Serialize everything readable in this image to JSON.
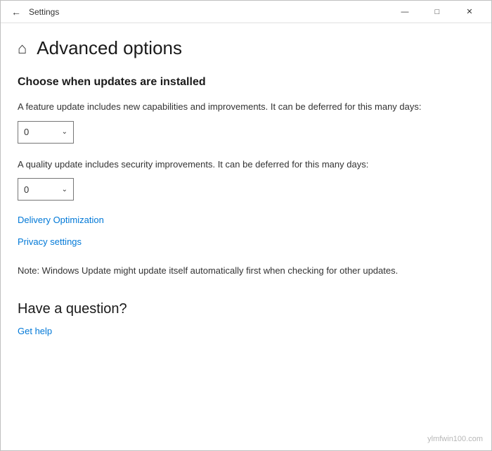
{
  "window": {
    "title": "Settings"
  },
  "titlebar": {
    "back_label": "←",
    "minimize_label": "—",
    "maximize_label": "□",
    "close_label": "✕"
  },
  "page": {
    "home_icon": "⌂",
    "title": "Advanced options",
    "section_title": "Choose when updates are installed",
    "feature_update_description": "A feature update includes new capabilities and improvements. It can be deferred for this many days:",
    "feature_update_value": "0",
    "quality_update_description": "A quality update includes security improvements. It can be deferred for this many days:",
    "quality_update_value": "0",
    "delivery_optimization_link": "Delivery Optimization",
    "privacy_settings_link": "Privacy settings",
    "note_text": "Note: Windows Update might update itself automatically first when checking for other updates.",
    "question_title": "Have a question?",
    "get_help_link": "Get help"
  },
  "watermark": "ylmfwin100.com"
}
